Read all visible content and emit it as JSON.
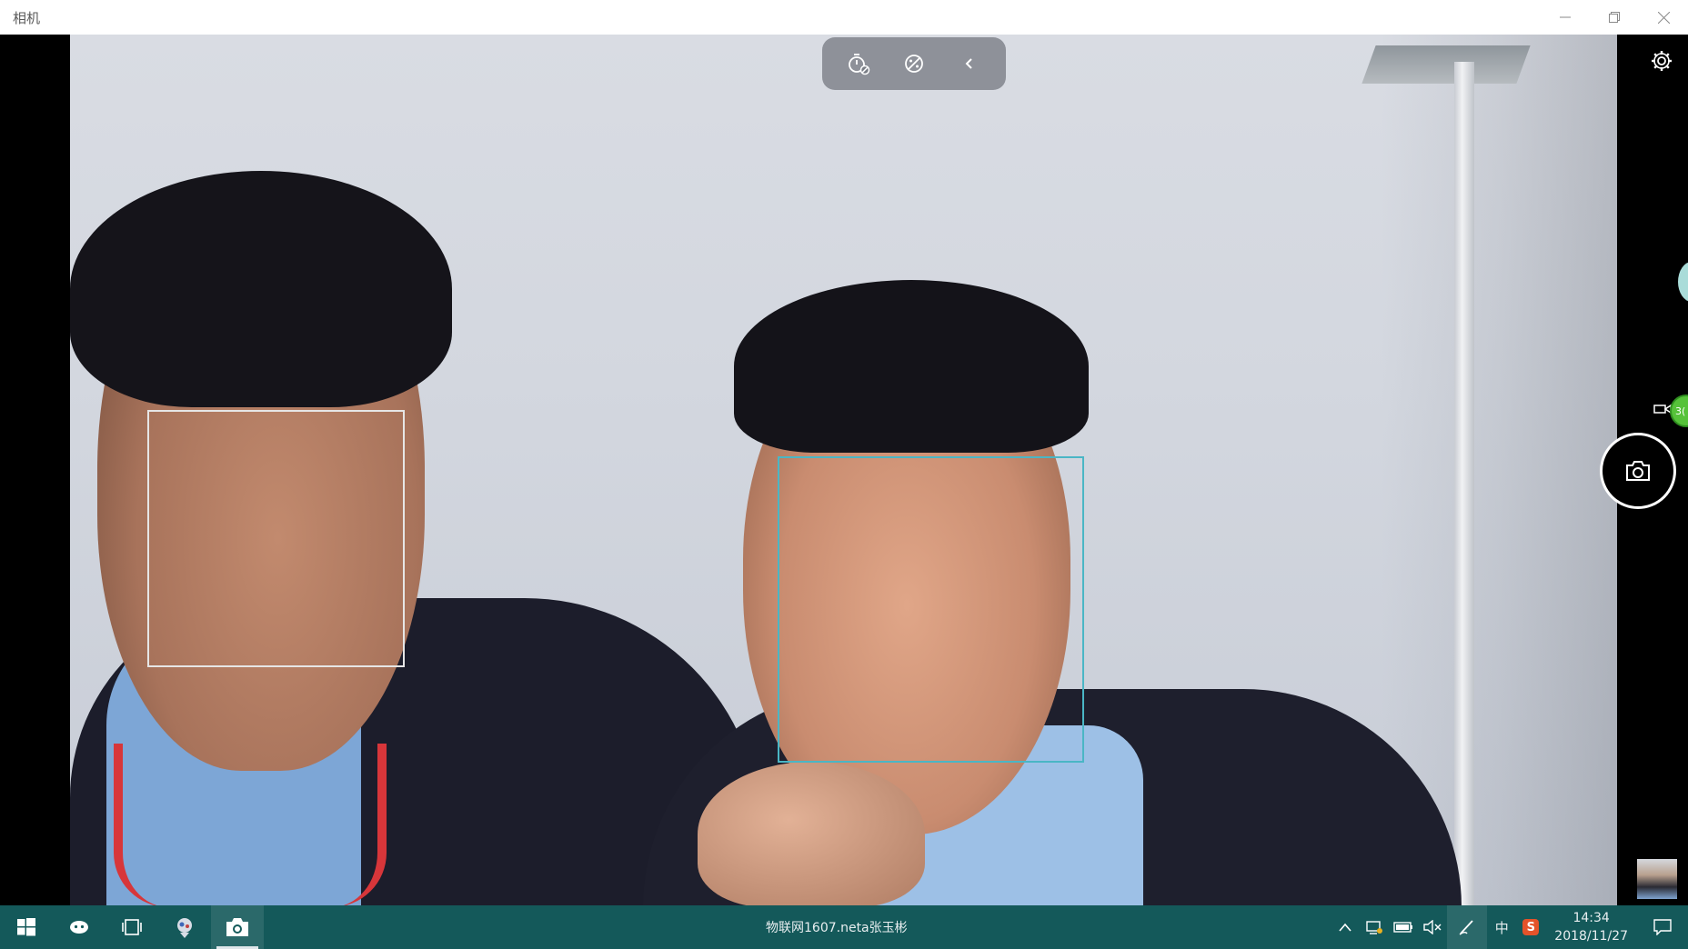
{
  "window": {
    "title": "相机",
    "controls": [
      "minimize-icon",
      "restore-icon",
      "close-icon"
    ]
  },
  "toolbar": {
    "icons": [
      "timer-off-icon",
      "hdr-off-icon",
      "collapse-chevron-icon"
    ]
  },
  "right_panel": {
    "settings_icon": "gear-icon",
    "mode_icon": "video-camera-icon",
    "badge_text": "3(",
    "shutter_icon": "camera-icon",
    "accent": "#56c23a"
  },
  "face_boxes": {
    "primary_color": "#e6e6e6",
    "secondary_color": "#4ab6c5"
  },
  "taskbar": {
    "bg_color": "#14595a",
    "center_text": "物联网1607.neta张玉彬",
    "pinned": [
      "windows-start-icon",
      "cortana-icon",
      "task-view-icon",
      "app-icon",
      "camera-app-icon"
    ],
    "tray": {
      "ime": "中",
      "sogou": "S",
      "time": "14:34",
      "date": "2018/11/27"
    }
  }
}
